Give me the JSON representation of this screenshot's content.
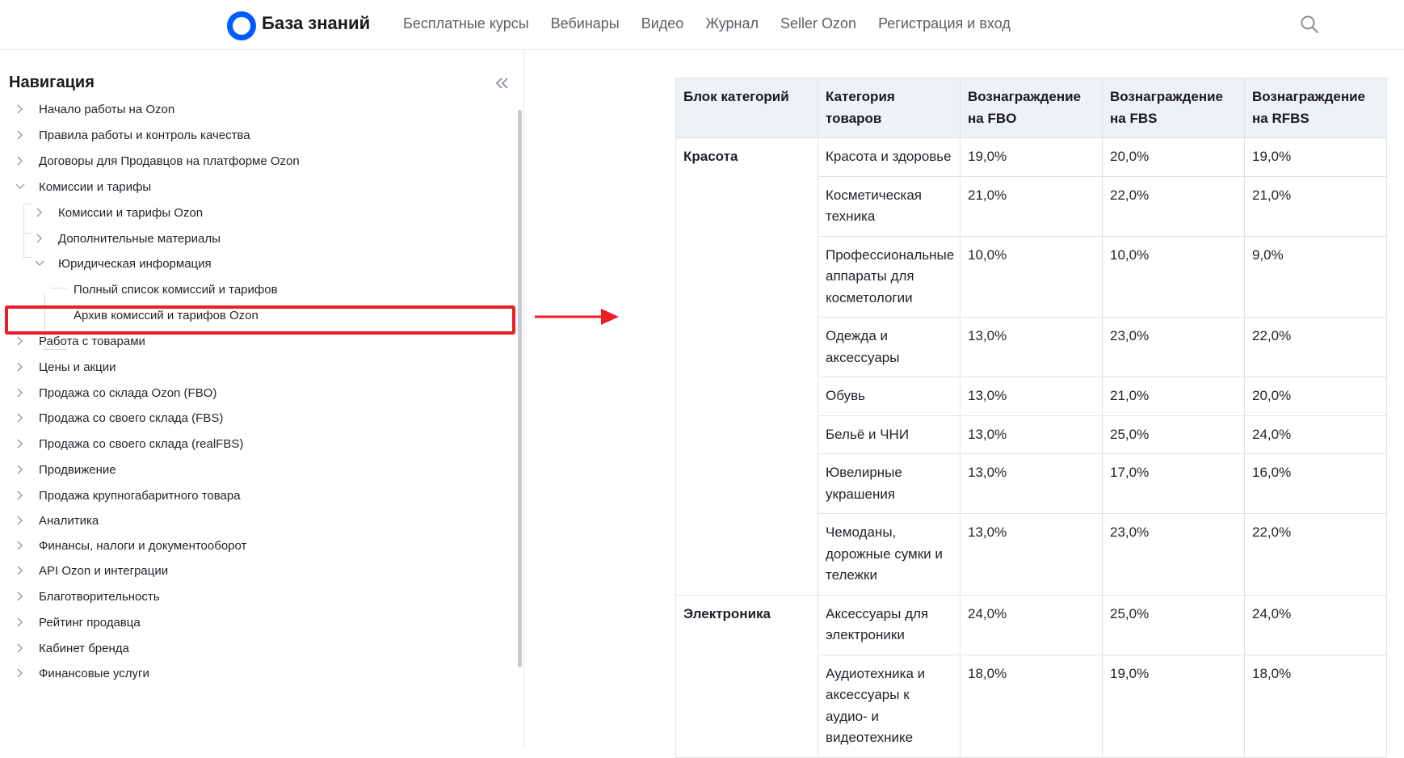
{
  "header": {
    "brand": "База знаний",
    "nav": [
      "Бесплатные курсы",
      "Вебинары",
      "Видео",
      "Журнал",
      "Seller Ozon",
      "Регистрация и вход"
    ],
    "logo_color": "#005bff"
  },
  "sidebar": {
    "title": "Навигация",
    "items": [
      {
        "label": "Начало работы на Ozon",
        "level": 0,
        "state": "collapsed"
      },
      {
        "label": "Правила работы и контроль качества",
        "level": 0,
        "state": "collapsed"
      },
      {
        "label": "Договоры для Продавцов на платформе Ozon",
        "level": 0,
        "state": "collapsed"
      },
      {
        "label": "Комиссии и тарифы",
        "level": 0,
        "state": "expanded"
      },
      {
        "label": "Комиссии и тарифы Ozon",
        "level": 1,
        "state": "collapsed"
      },
      {
        "label": "Дополнительные материалы",
        "level": 1,
        "state": "collapsed"
      },
      {
        "label": "Юридическая информация",
        "level": 1,
        "state": "expanded"
      },
      {
        "label": "Полный список комиссий и тарифов",
        "level": 2,
        "state": "leaf",
        "selected": true
      },
      {
        "label": "Архив комиссий и тарифов Ozon",
        "level": 2,
        "state": "leaf"
      },
      {
        "label": "Работа с товарами",
        "level": 0,
        "state": "collapsed"
      },
      {
        "label": "Цены и акции",
        "level": 0,
        "state": "collapsed"
      },
      {
        "label": "Продажа со склада Ozon (FBO)",
        "level": 0,
        "state": "collapsed"
      },
      {
        "label": "Продажа со своего склада (FBS)",
        "level": 0,
        "state": "collapsed"
      },
      {
        "label": "Продажа со своего склада (realFBS)",
        "level": 0,
        "state": "collapsed"
      },
      {
        "label": "Продвижение",
        "level": 0,
        "state": "collapsed"
      },
      {
        "label": "Продажа крупногабаритного товара",
        "level": 0,
        "state": "collapsed"
      },
      {
        "label": "Аналитика",
        "level": 0,
        "state": "collapsed"
      },
      {
        "label": "Финансы, налоги и документооборот",
        "level": 0,
        "state": "collapsed"
      },
      {
        "label": "API Ozon и интеграции",
        "level": 0,
        "state": "collapsed"
      },
      {
        "label": "Благотворительность",
        "level": 0,
        "state": "collapsed"
      },
      {
        "label": "Рейтинг продавца",
        "level": 0,
        "state": "collapsed"
      },
      {
        "label": "Кабинет бренда",
        "level": 0,
        "state": "collapsed"
      },
      {
        "label": "Финансовые услуги",
        "level": 0,
        "state": "collapsed"
      }
    ]
  },
  "annotation": {
    "color": "#ee1c25"
  },
  "table": {
    "headers": [
      "Блок категорий",
      "Категория товаров",
      "Вознаграждение на FBO",
      "Вознаграждение на FBS",
      "Вознаграждение на RFBS"
    ],
    "groups": [
      {
        "block": "Красота",
        "rows": [
          [
            "Красота и здоровье",
            "19,0%",
            "20,0%",
            "19,0%"
          ],
          [
            "Косметическая техника",
            "21,0%",
            "22,0%",
            "21,0%"
          ],
          [
            "Профессиональные аппараты для косметологии",
            "10,0%",
            "10,0%",
            "9,0%"
          ],
          [
            "Одежда и аксессуары",
            "13,0%",
            "23,0%",
            "22,0%"
          ],
          [
            "Обувь",
            "13,0%",
            "21,0%",
            "20,0%"
          ],
          [
            "Бельё и ЧНИ",
            "13,0%",
            "25,0%",
            "24,0%"
          ],
          [
            "Ювелирные украшения",
            "13,0%",
            "17,0%",
            "16,0%"
          ],
          [
            "Чемоданы, дорожные сумки и тележки",
            "13,0%",
            "23,0%",
            "22,0%"
          ]
        ]
      },
      {
        "block": "Электроника",
        "rows": [
          [
            "Аксессуары для электроники",
            "24,0%",
            "25,0%",
            "24,0%"
          ],
          [
            "Аудиотехника и аксессуары к аудио- и видеотехнике",
            "18,0%",
            "19,0%",
            "18,0%"
          ]
        ]
      }
    ]
  }
}
